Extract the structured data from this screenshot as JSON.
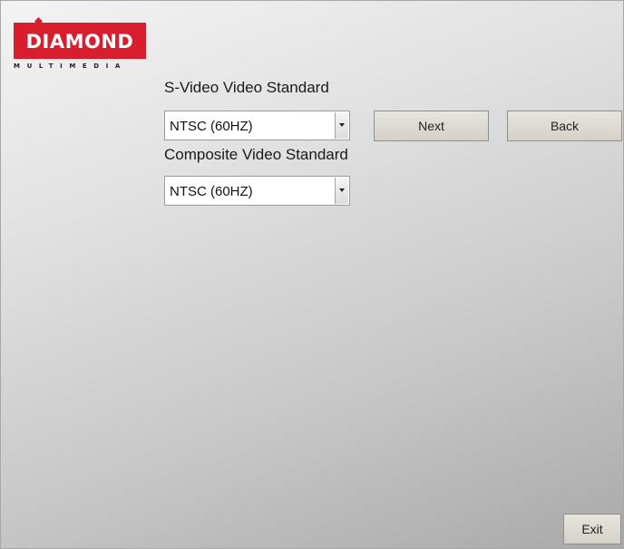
{
  "logo": {
    "word": "DIAMOND",
    "subtext": "MULTIMEDIA",
    "brand_color": "#d81e2c"
  },
  "svideo": {
    "label": "S-Video Video Standard",
    "selected": "NTSC (60HZ)"
  },
  "composite": {
    "label": "Composite Video Standard",
    "selected": "NTSC (60HZ)"
  },
  "buttons": {
    "next": "Next",
    "back": "Back",
    "exit": "Exit"
  }
}
